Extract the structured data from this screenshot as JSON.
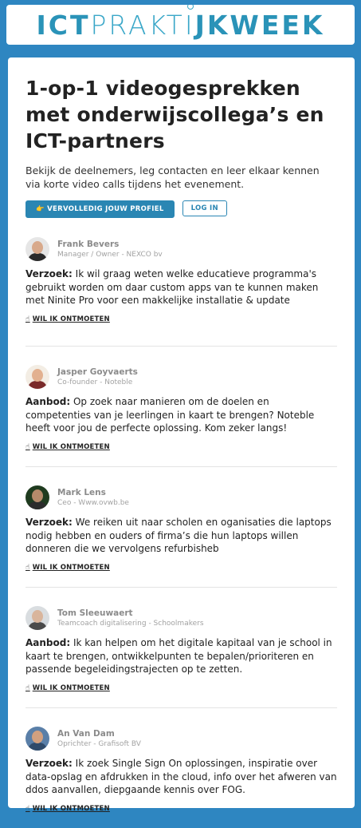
{
  "banner": {
    "logo_parts": [
      "ICT",
      "PRAKT",
      "I",
      "J",
      "KWEEK"
    ]
  },
  "page": {
    "title": "1-op-1 videogesprekken met onderwijscollega’s en ICT-partners",
    "intro": "Bekijk de deelnemers, leg contacten en leer elkaar kennen via korte video calls tijdens het evenement.",
    "complete_profile_label": "VERVOLLEDIG JOUW PROFIEL",
    "complete_profile_icon": "👉",
    "login_label": "LOG IN"
  },
  "people": [
    {
      "name": "Frank Bevers",
      "role": "Manager / Owner - NEXCO bv",
      "kind": "Verzoek:",
      "text": "Ik wil graag weten welke educatieve programma's gebruikt worden om daar custom apps van te kunnen maken met Ninite Pro voor een makkelijke installatie & update",
      "meet_label": "WIL IK ONTMOETEN"
    },
    {
      "name": "Jasper Goyvaerts",
      "role": "Co-founder - Noteble",
      "kind": "Aanbod:",
      "text": "Op zoek naar manieren om de doelen en competenties van je leerlingen in kaart te brengen? Noteble heeft voor jou de perfecte oplossing. Kom zeker langs!",
      "meet_label": "WIL IK ONTMOETEN"
    },
    {
      "name": "Mark Lens",
      "role": "Ceo - Www.ovwb.be",
      "kind": "Verzoek:",
      "text": "We reiken uit naar scholen en oganisaties die laptops nodig hebben en ouders of firma’s die hun laptops willen donneren die we vervolgens refurbisheb",
      "meet_label": "WIL IK ONTMOETEN"
    },
    {
      "name": "Tom Sleeuwaert",
      "role": "Teamcoach digitalisering - Schoolmakers",
      "kind": "Aanbod:",
      "text": "Ik kan helpen om het digitale kapitaal van je school in kaart te brengen, ontwikkelpunten te bepalen/prioriteren en passende begeleidingstrajecten op te zetten.",
      "meet_label": "WIL IK ONTMOETEN"
    },
    {
      "name": "An Van Dam",
      "role": "Oprichter - Grafisoft BV",
      "kind": "Verzoek:",
      "text": "Ik zoek Single Sign On oplossingen, inspiratie over data-opslag en afdrukken in the cloud, info over het afweren van ddos aanvallen, diepgaande kennis over FOG.",
      "meet_label": "WIL IK ONTMOETEN"
    }
  ],
  "colors": {
    "background": "#2e86c1",
    "accent": "#2a86b3",
    "logo": "#2e9bbd"
  },
  "icons": {
    "meet": "thumbs-up-icon",
    "profile": "pointing-hand-icon"
  }
}
